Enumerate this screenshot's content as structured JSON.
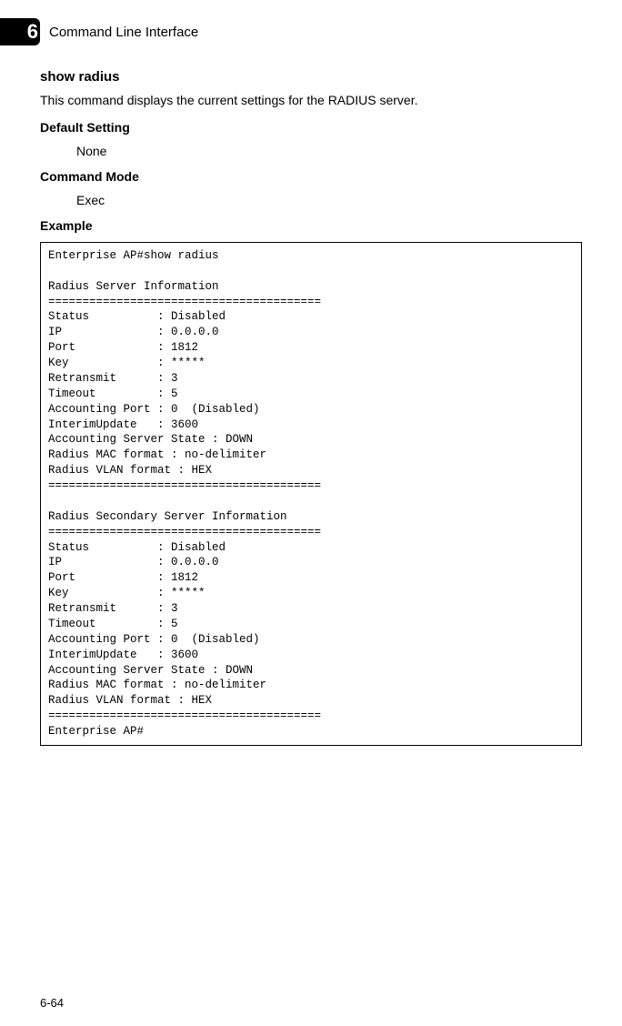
{
  "header": {
    "chapter_number": "6",
    "chapter_title": "Command Line Interface"
  },
  "command": {
    "name": "show radius",
    "description": "This command displays the current settings for the RADIUS server.",
    "default_setting_label": "Default Setting",
    "default_setting_value": "None",
    "command_mode_label": "Command Mode",
    "command_mode_value": "Exec",
    "example_label": "Example"
  },
  "terminal": "Enterprise AP#show radius\n\nRadius Server Information\n========================================\nStatus          : Disabled\nIP              : 0.0.0.0\nPort            : 1812\nKey             : *****\nRetransmit      : 3\nTimeout         : 5\nAccounting Port : 0  (Disabled)\nInterimUpdate   : 3600\nAccounting Server State : DOWN\nRadius MAC format : no-delimiter\nRadius VLAN format : HEX\n========================================\n\nRadius Secondary Server Information\n========================================\nStatus          : Disabled\nIP              : 0.0.0.0\nPort            : 1812\nKey             : *****\nRetransmit      : 3\nTimeout         : 5\nAccounting Port : 0  (Disabled)\nInterimUpdate   : 3600\nAccounting Server State : DOWN\nRadius MAC format : no-delimiter\nRadius VLAN format : HEX\n========================================\nEnterprise AP#",
  "page_number": "6-64"
}
